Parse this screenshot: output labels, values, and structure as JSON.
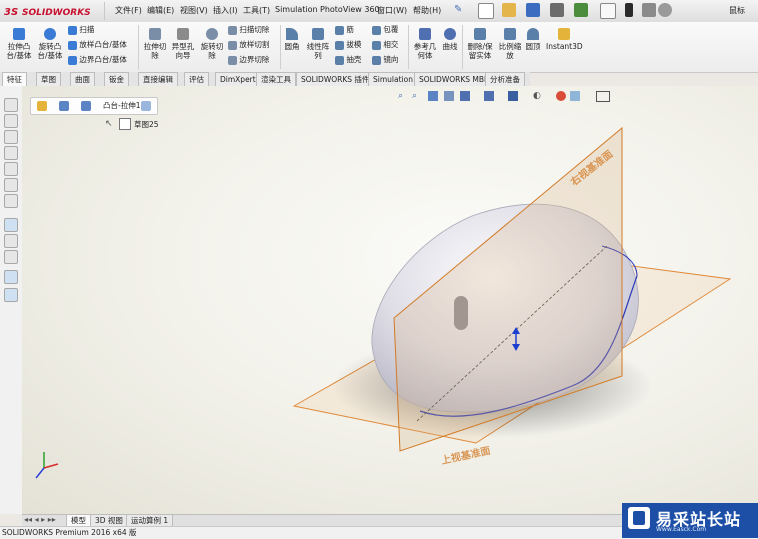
{
  "app": {
    "name": "SOLIDWORKS",
    "user": "鼠标"
  },
  "menu": [
    "文件(F)",
    "编辑(E)",
    "视图(V)",
    "插入(I)",
    "工具(T)",
    "Simulation",
    "PhotoView 360",
    "窗口(W)",
    "帮助(H)"
  ],
  "ribbon": {
    "extrude_boss": "拉伸凸\n台/基体",
    "revolve_boss": "旋转凸\n台/基体",
    "sweep": "扫描",
    "loft_boss": "放样凸台/基体",
    "boundary_boss": "边界凸台/基体",
    "extrude_cut": "拉伸切\n除",
    "hole_wizard": "异型孔\n向导",
    "revolve_cut": "旋转切\n除",
    "sweep_cut": "扫描切除",
    "loft_cut": "放样切割",
    "boundary_cut": "边界切除",
    "fillet": "圆角",
    "linear_pattern": "线性阵\n列",
    "rib": "筋",
    "draft": "拔模",
    "shell": "抽壳",
    "wrap": "包覆",
    "intersect": "相交",
    "mirror": "镜向",
    "ref_geometry": "参考几\n何体",
    "curves": "曲线",
    "delete_keep_body": "删除/保\n留实体",
    "scale": "比例缩\n放",
    "dome": "圆顶",
    "instant3d": "Instant3D"
  },
  "tabs": [
    "特征",
    "草图",
    "曲面",
    "钣金",
    "直接编辑",
    "评估",
    "DimXpert",
    "渲染工具",
    "SOLIDWORKS 插件",
    "Simulation",
    "SOLIDWORKS MBD",
    "分析准备"
  ],
  "active_tab": "特征",
  "breadcrumb": {
    "item": "凸台-拉伸1",
    "sub": "草图25"
  },
  "planes": {
    "right": "右视基准面",
    "top": "上视基准面"
  },
  "bottom_tabs": [
    "模型",
    "3D 视图",
    "运动算例 1"
  ],
  "active_bottom_tab": "模型",
  "status": "SOLIDWORKS Premium 2016 x64 版",
  "watermark": {
    "title": "易采站长站",
    "url": "Www.Easck.Com"
  },
  "colors": {
    "brand": "#c8102e",
    "plane": "#d98b3a",
    "accent": "#1d4fa6",
    "profile": "#2a36b8"
  }
}
